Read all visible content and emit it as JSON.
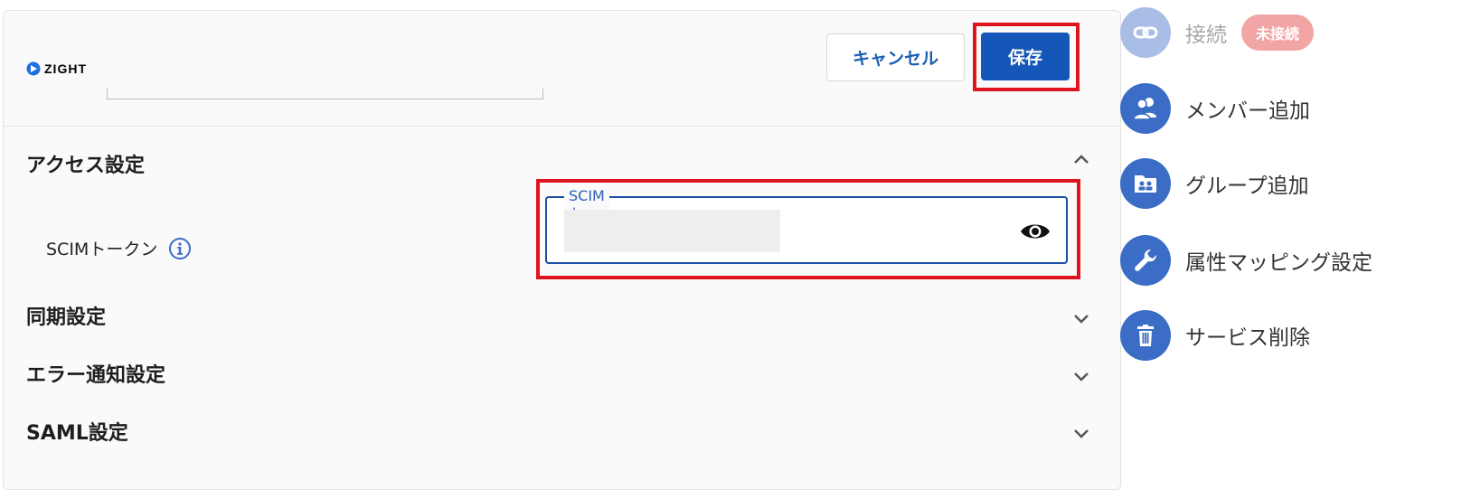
{
  "header": {
    "logo_text": "ZIGHT",
    "cancel_label": "キャンセル",
    "save_label": "保存"
  },
  "sections": [
    {
      "title": "アクセス設定",
      "expanded": true
    },
    {
      "title": "同期設定",
      "expanded": false
    },
    {
      "title": "エラー通知設定",
      "expanded": false
    },
    {
      "title": "SAML設定",
      "expanded": false
    }
  ],
  "access": {
    "scim_label": "SCIMトークン",
    "field_label": "SCIMトークン",
    "field_value": ""
  },
  "sidebar": {
    "items": [
      {
        "label": "接続",
        "icon": "link-icon",
        "disabled": true,
        "badge": "未接続"
      },
      {
        "label": "メンバー追加",
        "icon": "people-icon",
        "disabled": false
      },
      {
        "label": "グループ追加",
        "icon": "group-folder-icon",
        "disabled": false
      },
      {
        "label": "属性マッピング設定",
        "icon": "wrench-icon",
        "disabled": false
      },
      {
        "label": "サービス削除",
        "icon": "trash-icon",
        "disabled": false
      }
    ]
  },
  "colors": {
    "primary": "#1457b8",
    "highlight": "#e0141e",
    "sidebar_icon": "#3b6dc6",
    "sidebar_icon_disabled": "#a9bde6",
    "badge": "#f2a5a5"
  }
}
